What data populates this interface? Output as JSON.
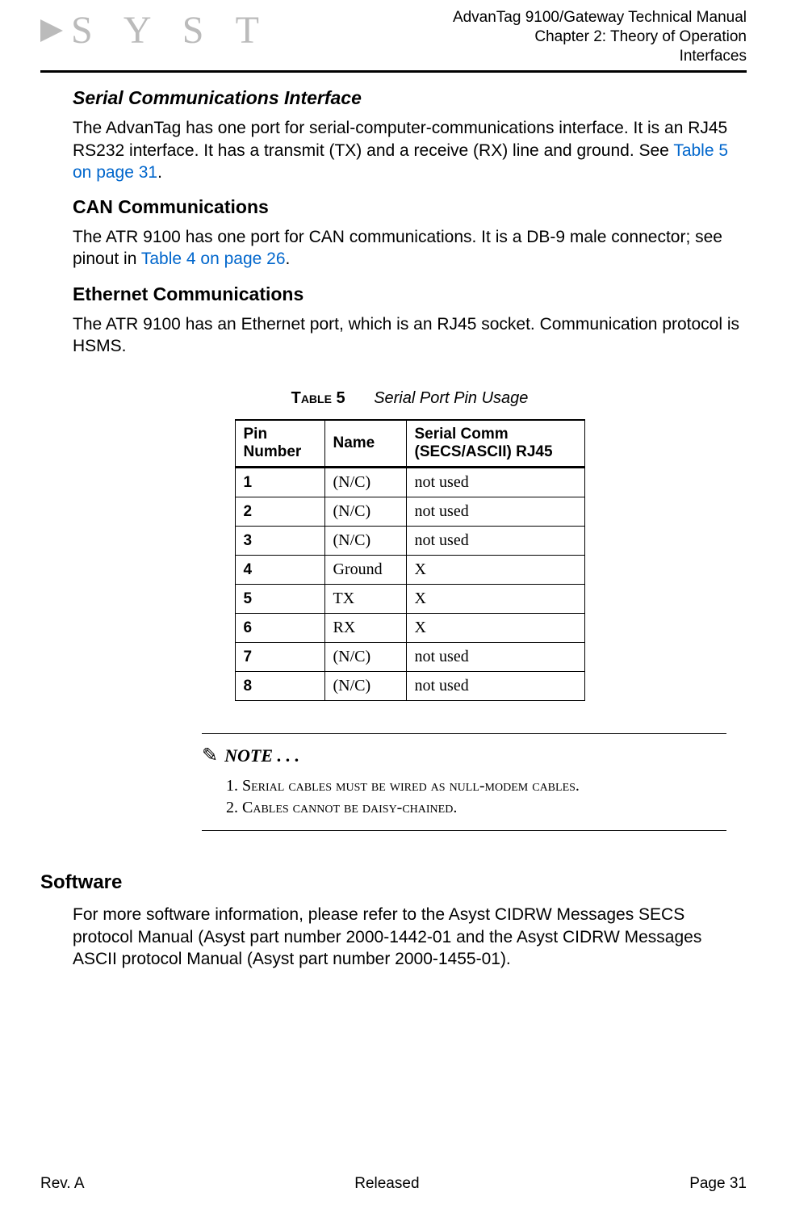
{
  "header": {
    "logo_text": "S Y S T",
    "line1": "AdvanTag 9100/Gateway Technical Manual",
    "line2": "Chapter 2: Theory of Operation",
    "line3": "Interfaces"
  },
  "sections": {
    "serial_title": "Serial Communications Interface",
    "serial_body_a": "The AdvanTag has one port for serial-computer-communications interface. It is an RJ45 RS232 interface. It has a transmit (TX) and a receive (RX) line and ground. See ",
    "serial_link": "Table 5 on page 31",
    "serial_body_b": ".",
    "can_title": "CAN Communications",
    "can_body_a": "The ATR 9100 has one port for CAN communications. It is a DB-9 male connector; see pinout in ",
    "can_link": "Table 4 on page 26",
    "can_body_b": ".",
    "eth_title": "Ethernet Communications",
    "eth_body": "The ATR 9100 has an Ethernet port, which is an RJ45 socket. Communication protocol is HSMS."
  },
  "table": {
    "label": "Table 5",
    "title": "Serial Port Pin Usage",
    "headers": {
      "pin": "Pin Number",
      "name": "Name",
      "usage": "Serial Comm (SECS/ASCII) RJ45"
    },
    "rows": [
      {
        "pin": "1",
        "name": "(N/C)",
        "usage": "not used"
      },
      {
        "pin": "2",
        "name": "(N/C)",
        "usage": "not used"
      },
      {
        "pin": "3",
        "name": "(N/C)",
        "usage": "not used"
      },
      {
        "pin": "4",
        "name": "Ground",
        "usage": "X"
      },
      {
        "pin": "5",
        "name": "TX",
        "usage": "X"
      },
      {
        "pin": "6",
        "name": "RX",
        "usage": "X"
      },
      {
        "pin": "7",
        "name": "(N/C)",
        "usage": "not used"
      },
      {
        "pin": "8",
        "name": "(N/C)",
        "usage": "not used"
      }
    ]
  },
  "note": {
    "title": "NOTE . . .",
    "item1": "1. Serial cables must be wired as null-modem cables.",
    "item2": "2. Cables cannot be daisy-chained."
  },
  "software": {
    "title": "Software",
    "body": "For more software information, please refer to the Asyst CIDRW Messages SECS protocol Manual (Asyst part number 2000-1442-01 and the Asyst CIDRW Messages ASCII protocol Manual (Asyst part number 2000-1455-01)."
  },
  "footer": {
    "left": "Rev. A",
    "center": "Released",
    "right": "Page 31"
  }
}
